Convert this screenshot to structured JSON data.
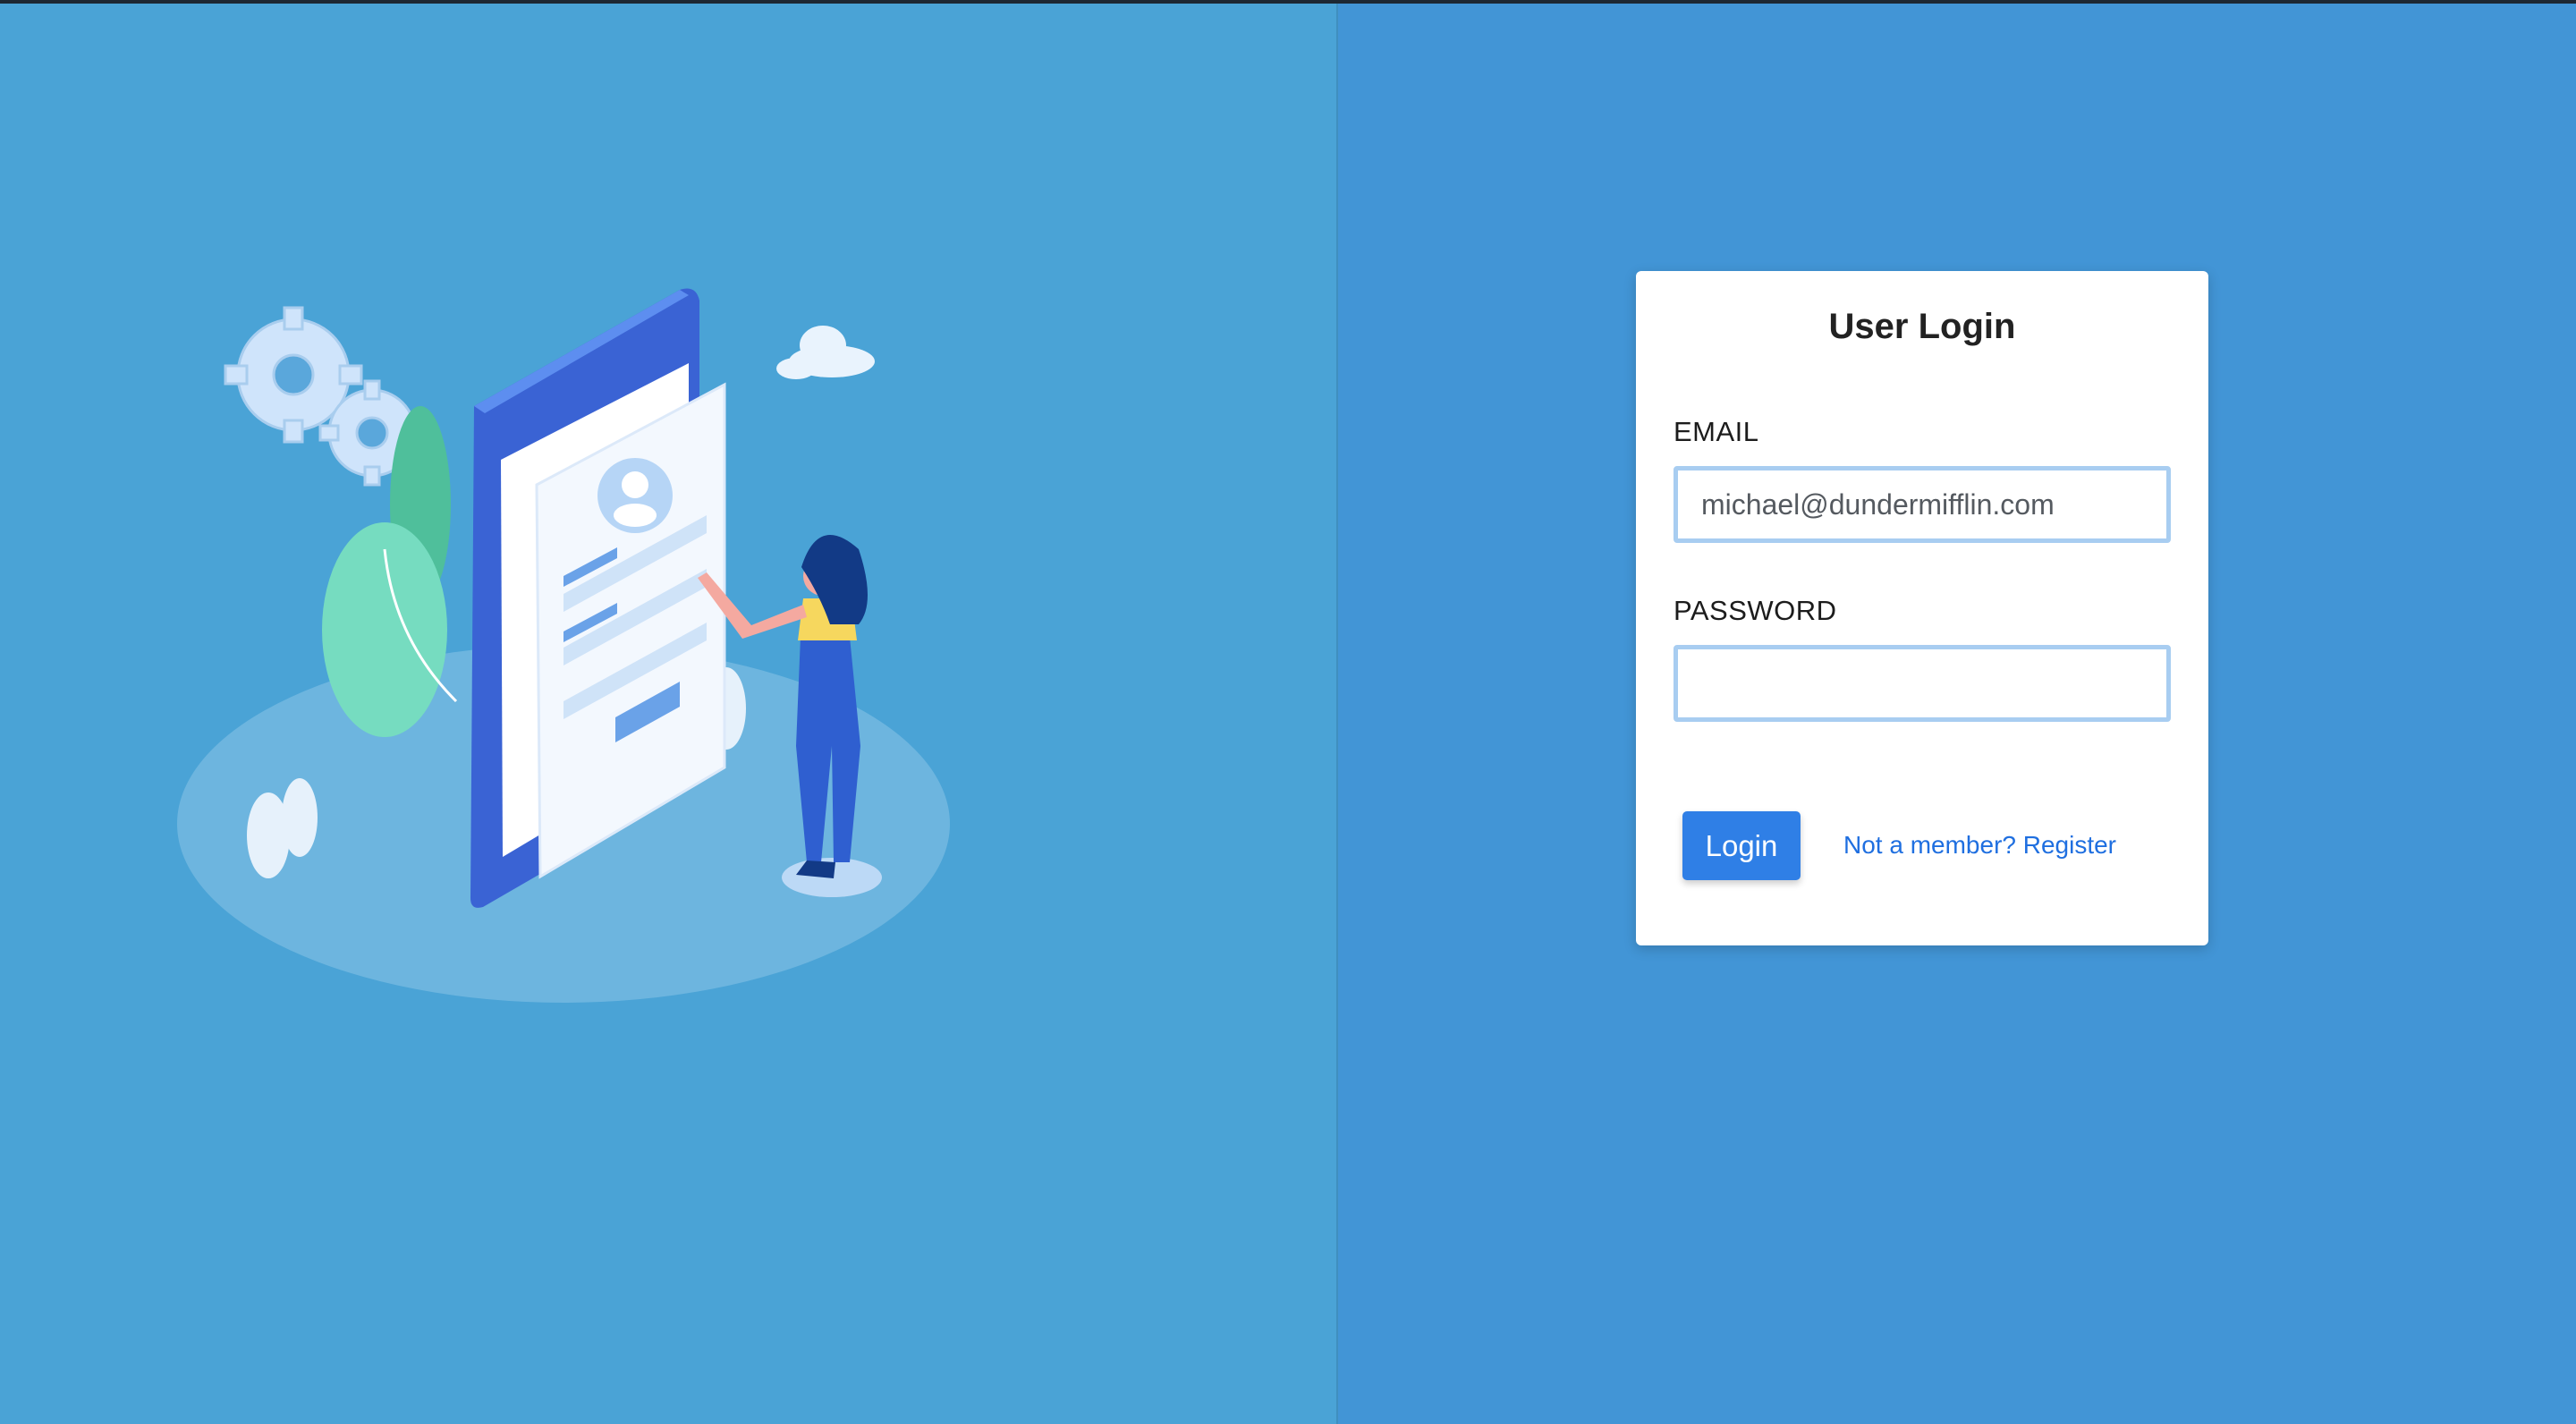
{
  "colors": {
    "left_bg": "#4aa3d6",
    "right_bg": "#4295d6",
    "card_bg": "#ffffff",
    "button_bg": "#2f7fe6",
    "link": "#1f6fe0",
    "input_border": "#a8cdf1"
  },
  "illustration": {
    "name": "phone-signup-illustration",
    "elements": [
      "gear-icon",
      "cloud-icon",
      "phone",
      "woman-figure",
      "plant"
    ]
  },
  "login": {
    "title": "User Login",
    "email_label": "EMAIL",
    "email_value": "michael@dundermifflin.com",
    "password_label": "PASSWORD",
    "password_value": "",
    "login_button": "Login",
    "register_link": "Not a member? Register"
  }
}
